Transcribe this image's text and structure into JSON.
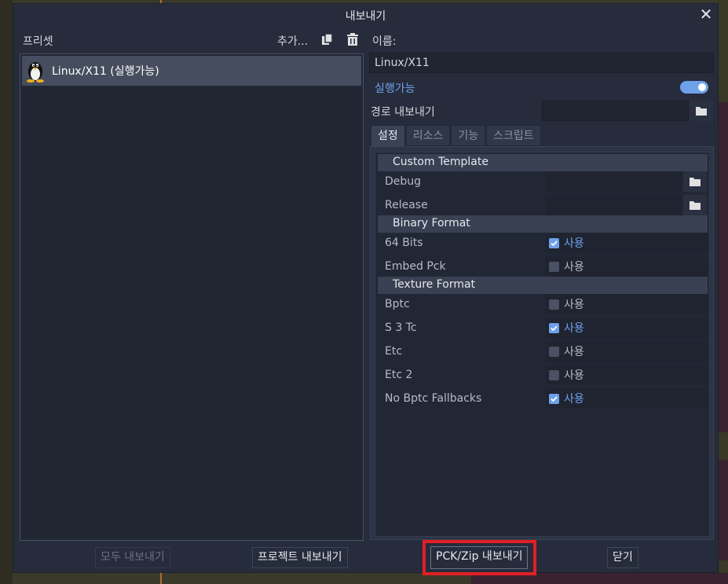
{
  "dialog": {
    "title": "내보내기",
    "close_glyph": "✕"
  },
  "presets": {
    "label": "프리셋",
    "add_label": "추가...",
    "items": [
      {
        "name": "Linux/X11 (실행가능)",
        "icon": "linux-penguin-icon"
      }
    ]
  },
  "details": {
    "name_label": "이름:",
    "name_value": "Linux/X11",
    "runnable_label": "실행가능",
    "runnable_on": true,
    "export_path_label": "경로 내보내기",
    "export_path_value": "",
    "tabs": [
      "설정",
      "리소스",
      "기능",
      "스크립트"
    ],
    "active_tab": 0
  },
  "options": {
    "sections": [
      {
        "title": "Custom Template",
        "props": [
          {
            "label": "Debug",
            "type": "file",
            "value": ""
          },
          {
            "label": "Release",
            "type": "file",
            "value": ""
          }
        ]
      },
      {
        "title": "Binary Format",
        "props": [
          {
            "label": "64 Bits",
            "type": "check",
            "checked": true,
            "text": "사용"
          },
          {
            "label": "Embed Pck",
            "type": "check",
            "checked": false,
            "text": "사용"
          }
        ]
      },
      {
        "title": "Texture Format",
        "props": [
          {
            "label": "Bptc",
            "type": "check",
            "checked": false,
            "text": "사용"
          },
          {
            "label": "S 3 Tc",
            "type": "check",
            "checked": true,
            "text": "사용"
          },
          {
            "label": "Etc",
            "type": "check",
            "checked": false,
            "text": "사용"
          },
          {
            "label": "Etc 2",
            "type": "check",
            "checked": false,
            "text": "사용"
          },
          {
            "label": "No Bptc Fallbacks",
            "type": "check",
            "checked": true,
            "text": "사용"
          }
        ]
      }
    ]
  },
  "buttons": {
    "export_all": "모두 내보내기",
    "export_project": "프로젝트 내보내기",
    "export_pck_zip": "PCK/Zip 내보내기",
    "close": "닫기"
  },
  "colors": {
    "accent": "#6ea1ea",
    "highlight_box": "#e11f25",
    "dialog_bg": "#262c3b"
  }
}
